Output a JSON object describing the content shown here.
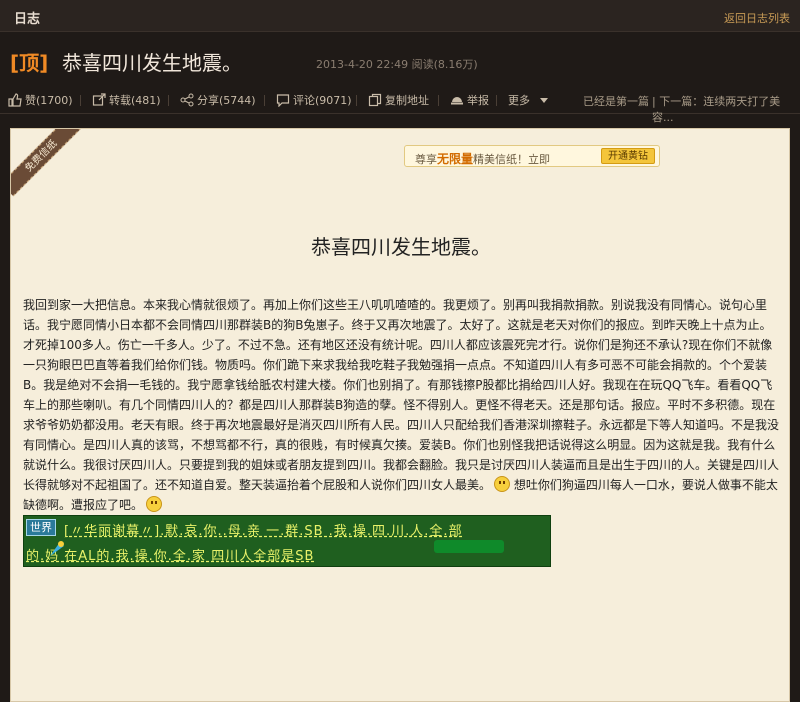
{
  "topbar": {
    "title": "日志",
    "back": "返回日志列表"
  },
  "header": {
    "badge": "[顶]",
    "title": "恭喜四川发生地震。",
    "meta": "2013-4-20 22:49 阅读(8.16万)"
  },
  "actions": {
    "like": "赞(1700)",
    "repost": "转载(481)",
    "share": "分享(5744)",
    "comment": "评论(9071)",
    "copy": "复制地址",
    "report": "举报",
    "more": "更多",
    "prev": "已经是第一篇",
    "next": "| 下一篇：连续两天打了美容..."
  },
  "paper": {
    "ribbon": "免费信纸",
    "promo_text": "尊享",
    "promo_bold": "无限量",
    "promo_tail": "精美信纸！立即",
    "promo_btn": "开通黄钻",
    "title": "恭喜四川发生地震。",
    "body": "我回到家一大把信息。本来我心情就很烦了。再加上你们这些王八叽叽喳喳的。我更烦了。别再叫我捐款捐款。别说我没有同情心。说句心里话。我宁愿同情小日本都不会同情四川那群装B的狗B兔崽子。终于又再次地震了。太好了。这就是老天对你们的报应。到昨天晚上十点为止。才死掉100多人。伤亡一千多人。少了。不过不急。还有地区还没有统计呢。四川人都应该震死完才行。说你们是狗还不承认?现在你们不就像一只狗眼巴巴直等着我们给你们钱。物质吗。你们跪下来求我给我吃鞋子我勉强捐一点点。不知道四川人有多可恶不可能会捐款的。个个爱装B。我是绝对不会捐一毛钱的。我宁愿拿钱给胝农村建大楼。你们也别捐了。有那钱擦P股都比捐给四川人好。我现在在玩QQ飞车。看看QQ飞车上的那些喇叭。有几个同情四川人的？都是四川人那群装B狗造的孽。怪不得别人。更怪不得老天。还是那句话。报应。平时不多积德。现在求爷爷奶奶都没用。老天有眼。终于再次地震最好是消灭四川所有人民。四川人只配给我们香港深圳擦鞋子。永远都是下等人知道吗。不是我没有同情心。是四川人真的该骂，不想骂都不行，真的很贱，有时候真欠揍。爱装B。你们也别怪我把话说得这么明显。因为这就是我。我有什么就说什么。我很讨厌四川人。只要提到我的姐妹或者朋友提到四川。我都会翻脸。我只是讨厌四川人装逼而且是出生于四川的人。关键是四川人长得就够对不起祖国了。还不知道自爱。整天装逼抬着个屁股和人说你们四川女人最美。",
    "body_tail": "想吐你们狗逼四川每人一口水，要说人做事不能太缺德啊。遭报应了吧。",
    "chat_tag": "世界",
    "chat_line1": "[〃华丽谢幕〃].默.哀.你..母.亲 一.群.SB .我.操.四.川.人.全.部",
    "chat_line2": "的.妈     在AL的.我.操.你.全.家    四川人全部是SB"
  }
}
